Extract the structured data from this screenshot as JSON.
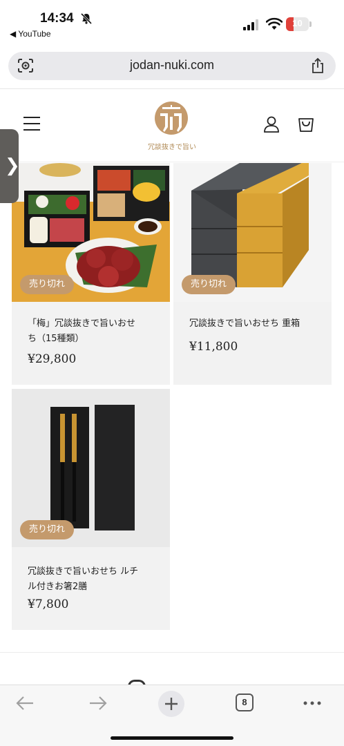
{
  "status_bar": {
    "time": "14:34",
    "back_app": "◀ YouTube",
    "battery_level": "10",
    "battery_fraction": 0.1,
    "icons": [
      "bell-slash-icon",
      "signal-icon",
      "wifi-icon",
      "battery-icon"
    ]
  },
  "browser": {
    "url": "jodan-nuki.com",
    "open_tabs": "8",
    "icons": [
      "lens-icon",
      "share-icon",
      "back-arrow-icon",
      "forward-arrow-icon",
      "plus-icon",
      "more-icon"
    ]
  },
  "site": {
    "logo_text": "冗談抜きで旨い",
    "brand_color": "#c49a6c",
    "icons": [
      "menu-icon",
      "account-icon",
      "cart-icon"
    ]
  },
  "side_tab": {
    "glyph": "❯"
  },
  "products": [
    {
      "badge": "売り切れ",
      "title_line1": "「梅」冗談抜きで旨いおせ",
      "title_line2": "ち（15種類）",
      "price": "¥29,800"
    },
    {
      "badge": "売り切れ",
      "title_line1": "冗談抜きで旨いおせち 重箱",
      "title_line2": "",
      "price": "¥11,800"
    },
    {
      "badge": "売り切れ",
      "title_line1": "冗談抜きで旨いおせち ルチ",
      "title_line2": "ル付きお箸2膳",
      "price": "¥7,800"
    }
  ]
}
